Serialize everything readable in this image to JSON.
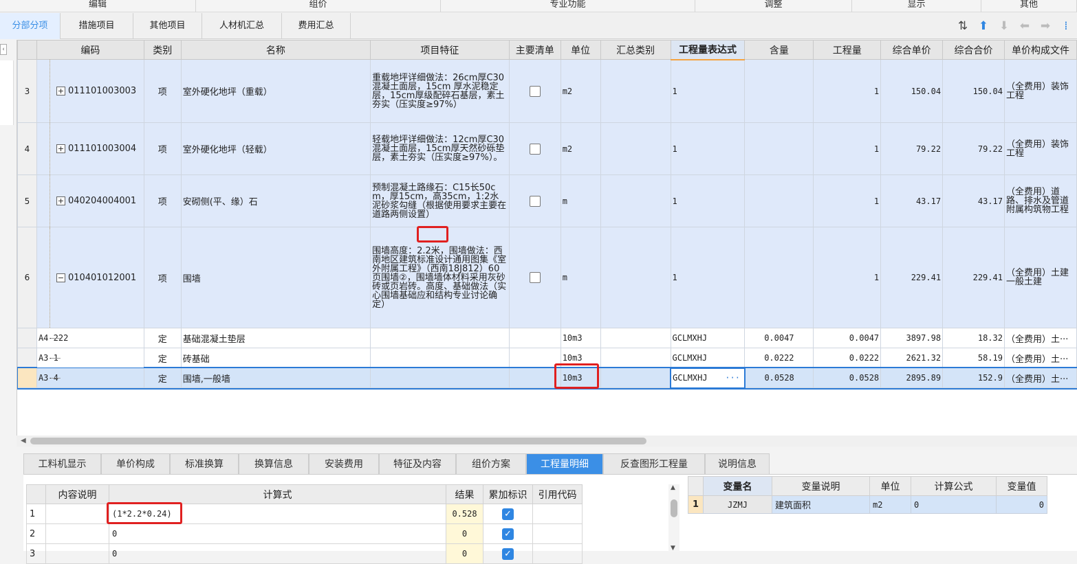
{
  "ribbon": [
    "编辑",
    "组价",
    "专业功能",
    "调整",
    "显示",
    "其他"
  ],
  "tabs": [
    {
      "label": "分部分项",
      "active": true
    },
    {
      "label": "措施项目"
    },
    {
      "label": "其他项目"
    },
    {
      "label": "人材机汇总"
    },
    {
      "label": "费用汇总"
    }
  ],
  "toolbar_icons": [
    "sort-icon",
    "arrow-up-icon",
    "arrow-down-icon",
    "arrow-left-icon",
    "arrow-right-icon",
    "more-icon"
  ],
  "grid": {
    "columns": [
      "编码",
      "类别",
      "名称",
      "项目特征",
      "主要清单",
      "单位",
      "汇总类别",
      "工程量表达式",
      "含量",
      "工程量",
      "综合单价",
      "综合合价",
      "单价构成文件"
    ],
    "items": [
      {
        "row": "3",
        "code": "011101003003",
        "type": "项",
        "name": "室外硬化地坪（重载）",
        "feature": "重载地坪详细做法：26cm厚C30混凝土面层，15cm 厚水泥稳定层，15cm厚级配碎石基层，素土夯实（压实度≥97%）",
        "unit": "m2",
        "expr": "1",
        "qty": "1",
        "price": "150.04",
        "total": "150.04",
        "file": "（全费用）装饰工程",
        "expander": "+"
      },
      {
        "row": "4",
        "code": "011101003004",
        "type": "项",
        "name": "室外硬化地坪（轻载）",
        "feature": "轻载地坪详细做法：12cm厚C30混凝土面层，15cm厚天然砂砾垫层，素土夯实（压实度≥97%）。",
        "unit": "m2",
        "expr": "1",
        "qty": "1",
        "price": "79.22",
        "total": "79.22",
        "file": "（全费用）装饰工程",
        "expander": "+"
      },
      {
        "row": "5",
        "code": "040204004001",
        "type": "项",
        "name": "安砌侧(平、缘）石",
        "feature": "预制混凝土路缘石：C15长50cm，厚15cm，高35cm，1:2水泥砂浆勾缝（根据使用要求主要在道路两侧设置）",
        "unit": "m",
        "expr": "1",
        "qty": "1",
        "price": "43.17",
        "total": "43.17",
        "file": "（全费用）道路、排水及管道附属构筑物工程",
        "expander": "+"
      },
      {
        "row": "6",
        "code": "010401012001",
        "type": "项",
        "name": "围墙",
        "feature": "围墙高度：2.2米，围墙做法：西南地区建筑标准设计通用图集《室外附属工程》（西南18J812）60页围墙②，围墙墙体材料采用灰砂砖或页岩砖。高度、基础做法（实心围墙基础应和结构专业讨论确定）",
        "unit": "m",
        "expr": "1",
        "qty": "1",
        "price": "229.41",
        "total": "229.41",
        "file": "（全费用）土建一般土建",
        "expander": "−"
      }
    ],
    "subs": [
      {
        "code": "A4-222",
        "type": "定",
        "name": "基础混凝土垫层",
        "unit": "10m3",
        "expr": "GCLMXHJ",
        "content": "0.0047",
        "qty": "0.0047",
        "price": "3897.98",
        "total": "18.32",
        "file": "（全费用）土···"
      },
      {
        "code": "A3-1",
        "type": "定",
        "name": "砖基础",
        "unit": "10m3",
        "expr": "GCLMXHJ",
        "content": "0.0222",
        "qty": "0.0222",
        "price": "2621.32",
        "total": "58.19",
        "file": "（全费用）土···"
      },
      {
        "code": "A3-4",
        "type": "定",
        "name": "围墙,一般墙",
        "unit": "10m3",
        "expr": "GCLMXHJ",
        "expr_more": "···",
        "content": "0.0528",
        "qty": "0.0528",
        "price": "2895.89",
        "total": "152.9",
        "file": "（全费用）土···"
      }
    ]
  },
  "bottom_tabs": [
    {
      "label": "工料机显示"
    },
    {
      "label": "单价构成"
    },
    {
      "label": "标准换算"
    },
    {
      "label": "换算信息"
    },
    {
      "label": "安装费用"
    },
    {
      "label": "特征及内容"
    },
    {
      "label": "组价方案"
    },
    {
      "label": "工程量明细",
      "active": true
    },
    {
      "label": "反查图形工程量"
    },
    {
      "label": "说明信息"
    }
  ],
  "calc": {
    "columns": [
      "内容说明",
      "计算式",
      "结果",
      "累加标识",
      "引用代码"
    ],
    "rows": [
      {
        "no": "1",
        "formula": "(1*2.2*0.24)",
        "result": "0.528"
      },
      {
        "no": "2",
        "formula": "0",
        "result": "0"
      },
      {
        "no": "3",
        "formula": "0",
        "result": "0"
      }
    ]
  },
  "vars": {
    "columns": [
      "变量名",
      "变量说明",
      "单位",
      "计算公式",
      "变量值"
    ],
    "rows": [
      {
        "no": "1",
        "name": "JZMJ",
        "desc": "建筑面积",
        "unit": "m2",
        "formula": "0",
        "value": "0"
      }
    ]
  }
}
